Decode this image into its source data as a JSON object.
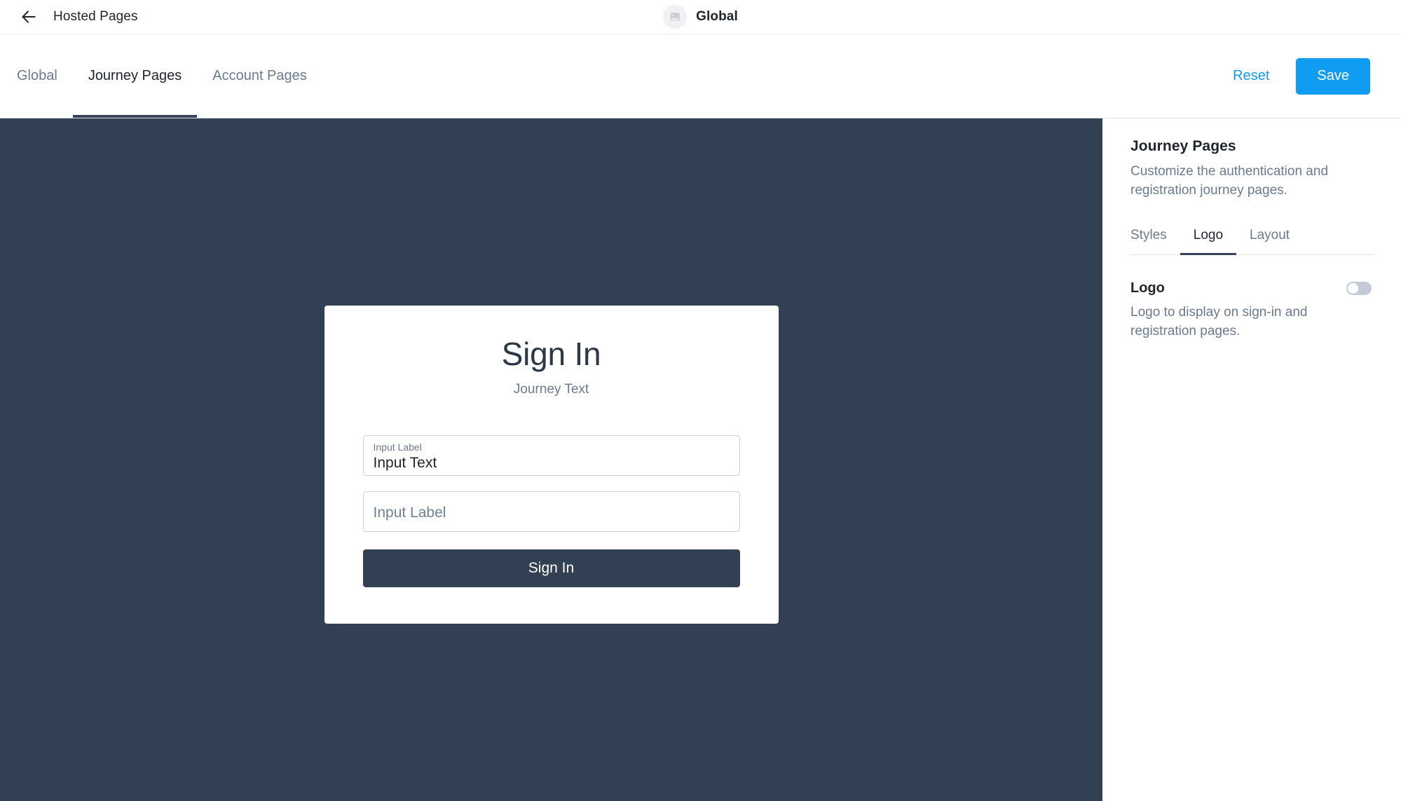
{
  "topbar": {
    "back_icon": "arrow-left-icon",
    "title": "Hosted Pages",
    "realm_icon": "image-placeholder-icon",
    "realm_name": "Global"
  },
  "tabbar": {
    "tabs": [
      {
        "label": "Global",
        "active": false
      },
      {
        "label": "Journey Pages",
        "active": true
      },
      {
        "label": "Account Pages",
        "active": false
      }
    ],
    "reset_label": "Reset",
    "save_label": "Save",
    "accent_color": "#109cf1"
  },
  "preview": {
    "background_color": "#324054",
    "card": {
      "title": "Sign In",
      "subtitle": "Journey Text",
      "fields": [
        {
          "label": "Input Label",
          "value": "Input Text"
        },
        {
          "placeholder": "Input Label"
        }
      ],
      "button_label": "Sign In",
      "button_color": "#324054"
    }
  },
  "sidebar": {
    "title": "Journey Pages",
    "description": "Customize the authentication and registration journey pages.",
    "subtabs": [
      {
        "label": "Styles",
        "active": false
      },
      {
        "label": "Logo",
        "active": true
      },
      {
        "label": "Layout",
        "active": false
      }
    ],
    "settings": [
      {
        "title": "Logo",
        "description": "Logo to display on sign-in and registration pages.",
        "toggle_state": "off"
      }
    ]
  }
}
